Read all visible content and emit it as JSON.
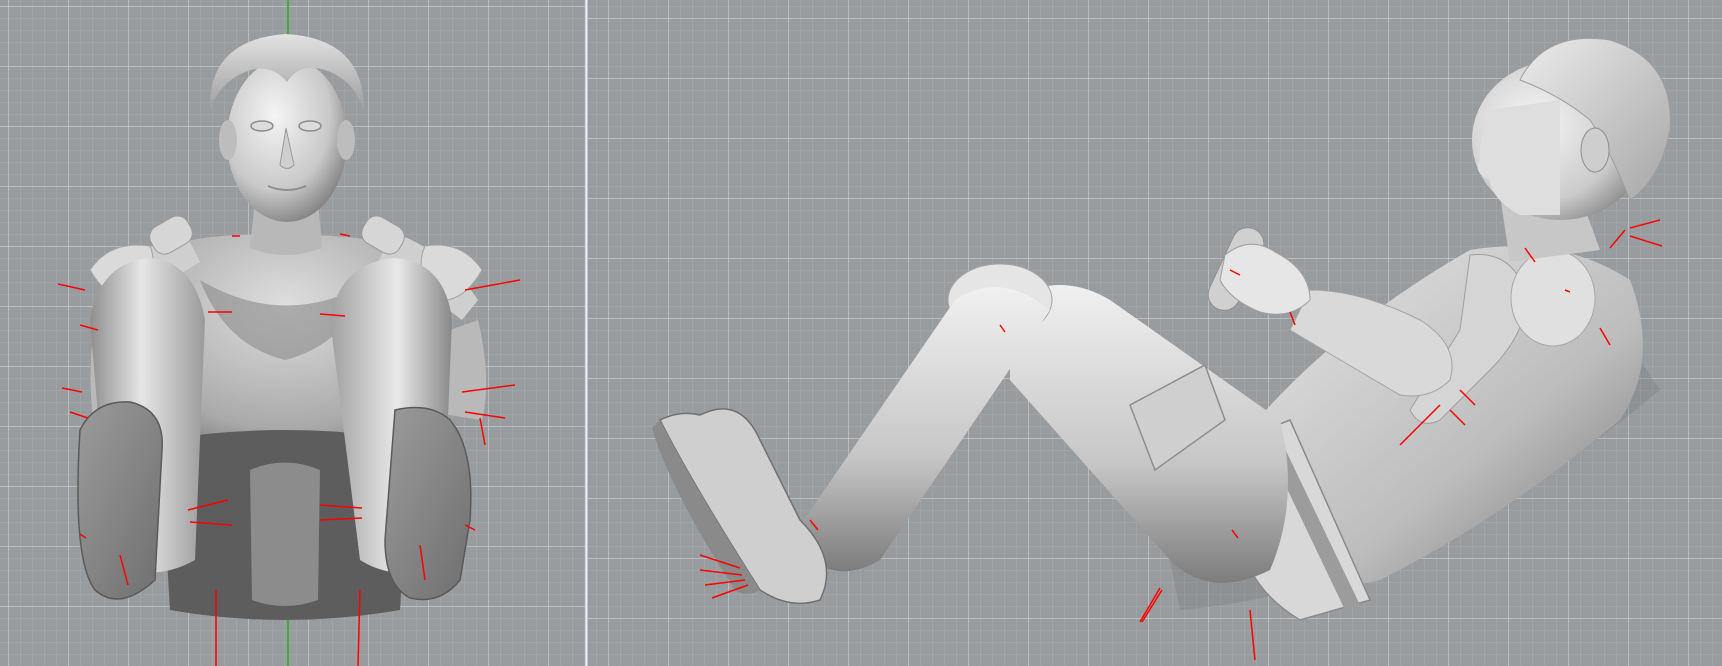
{
  "app": {
    "viewports": [
      {
        "name": "front",
        "label": ""
      },
      {
        "name": "right",
        "label": ""
      }
    ]
  },
  "colors": {
    "background": "#999c9e",
    "grid_major": "#cdd0d2",
    "grid_minor": "#aaadaf",
    "world_y_axis": "#3fae3f",
    "splitter": "#ffffff",
    "surface_light": "#f2f2f2",
    "surface_mid": "#c4c4c4",
    "surface_dark": "#6e6e6e",
    "normal_marker": "#ff0000"
  },
  "icons": {
    "front_model": "figure-front-view-icon",
    "side_model": "figure-side-view-icon"
  }
}
